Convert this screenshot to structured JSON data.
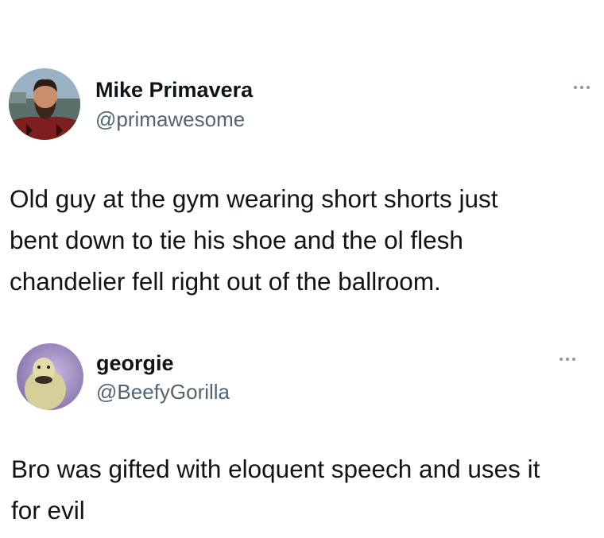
{
  "tweets": [
    {
      "name": "Mike Primavera",
      "handle": "@primawesome",
      "text": "Old guy at the gym wearing short shorts just\nbent down to tie his shoe and the ol flesh\nchandelier fell right out of the ballroom."
    },
    {
      "name": "georgie",
      "handle": "@BeefyGorilla",
      "text": "Bro was gifted with eloquent speech and uses it\nfor evil"
    }
  ],
  "icons": {
    "more": "more-options-icon"
  }
}
